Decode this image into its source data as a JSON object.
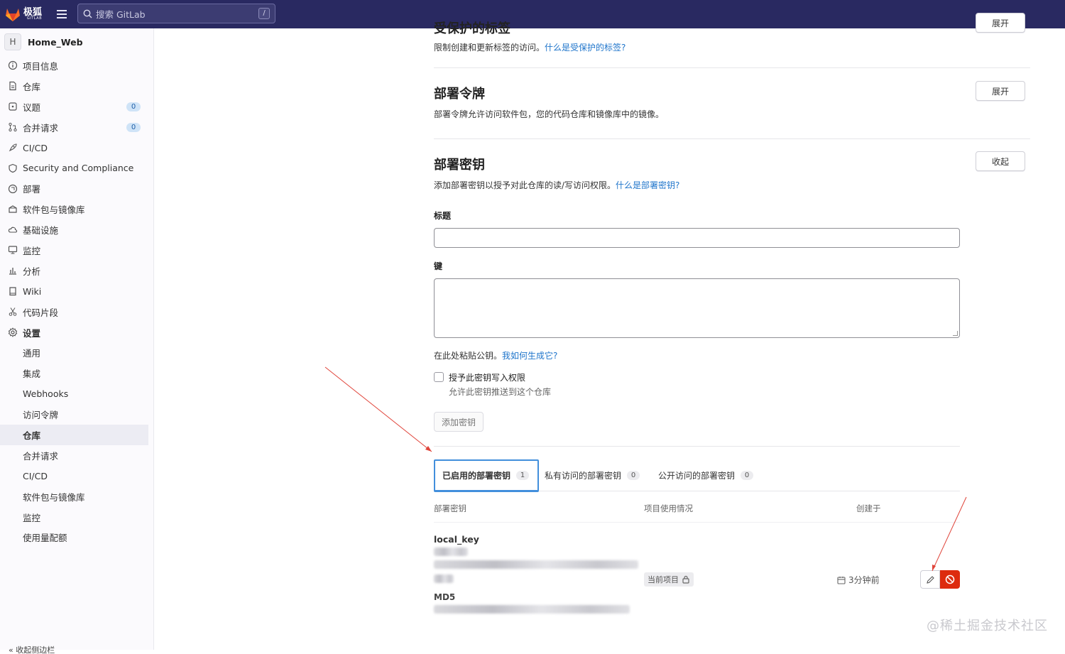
{
  "topbar": {
    "logo_text": "极狐",
    "logo_sub": "GITLAB",
    "search_placeholder": "搜索 GitLab",
    "search_shortcut": "/"
  },
  "sidebar": {
    "project_initial": "H",
    "project_name": "Home_Web",
    "items": [
      {
        "label": "项目信息",
        "icon": "info-icon"
      },
      {
        "label": "仓库",
        "icon": "doc-icon"
      },
      {
        "label": "议题",
        "icon": "issues-icon",
        "badge": "0"
      },
      {
        "label": "合并请求",
        "icon": "merge-request-icon",
        "badge": "0"
      },
      {
        "label": "CI/CD",
        "icon": "rocket-icon"
      },
      {
        "label": "Security and Compliance",
        "icon": "shield-icon"
      },
      {
        "label": "部署",
        "icon": "deploy-icon"
      },
      {
        "label": "软件包与镜像库",
        "icon": "package-icon"
      },
      {
        "label": "基础设施",
        "icon": "cloud-icon"
      },
      {
        "label": "监控",
        "icon": "monitor-icon"
      },
      {
        "label": "分析",
        "icon": "chart-icon"
      },
      {
        "label": "Wiki",
        "icon": "book-icon"
      },
      {
        "label": "代码片段",
        "icon": "scissors-icon"
      },
      {
        "label": "设置",
        "icon": "gear-icon"
      }
    ],
    "settings_sub": [
      "通用",
      "集成",
      "Webhooks",
      "访问令牌",
      "仓库",
      "合并请求",
      "CI/CD",
      "软件包与镜像库",
      "监控",
      "使用量配额"
    ],
    "active_sub": "仓库",
    "collapse_label": "收起侧边栏"
  },
  "protected_tags": {
    "title": "受保护的标签",
    "desc": "限制创建和更新标签的访问。",
    "link": "什么是受保护的标签?",
    "button": "展开"
  },
  "deploy_tokens": {
    "title": "部署令牌",
    "desc": "部署令牌允许访问软件包，您的代码仓库和镜像库中的镜像。",
    "button": "展开"
  },
  "deploy_keys": {
    "title": "部署密钥",
    "desc": "添加部署密钥以授予对此仓库的读/写访问权限。",
    "link": "什么是部署密钥?",
    "button": "收起",
    "title_label": "标题",
    "key_label": "键",
    "paste_help": "在此处粘贴公钥。",
    "paste_link": "我如何生成它?",
    "write_label": "授予此密钥写入权限",
    "write_help": "允许此密钥推送到这个仓库",
    "add_button": "添加密钥",
    "tabs": [
      {
        "label": "已启用的部署密钥",
        "count": "1"
      },
      {
        "label": "私有访问的部署密钥",
        "count": "0"
      },
      {
        "label": "公开访问的部署密钥",
        "count": "0"
      }
    ],
    "columns": [
      "部署密钥",
      "项目使用情况",
      "创建于"
    ],
    "rows": [
      {
        "name": "local_key",
        "fingerprint_partial": "...5Wxu...wcDGHzBFuhyy58...",
        "md5_label": "MD5",
        "md5_partial": "...c6:7...45:cc:01:45:5c...",
        "usage": "当前项目",
        "created": "3分钟前"
      }
    ]
  },
  "watermark": "@稀土掘金技术社区"
}
